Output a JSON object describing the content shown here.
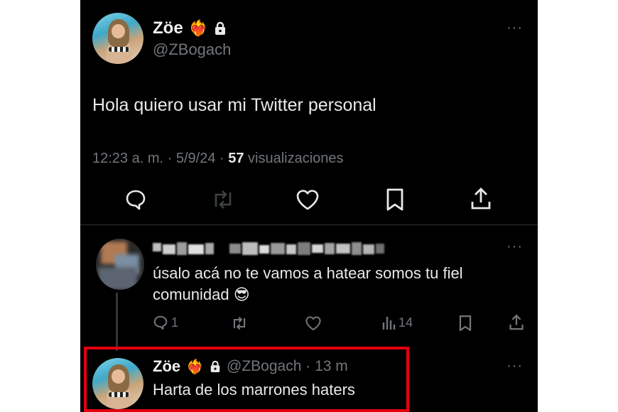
{
  "main_tweet": {
    "author_name": "Zöe",
    "name_emoji": "❤️‍🔥",
    "handle": "@ZBogach",
    "text": "Hola quiero usar mi Twitter personal",
    "time": "12:23 a. m. · 5/9/24 · ",
    "views_count": "57",
    "views_label": " visualizaciones",
    "more": "···"
  },
  "reply_1": {
    "text_line1": "úsalo acá no te vamos a hatear somos tu fiel",
    "text_line2": "comunidad",
    "emoji": "😎",
    "reply_count": "1",
    "views_count": "14",
    "more": "···"
  },
  "reply_2": {
    "author_name": "Zöe",
    "name_emoji": "❤️‍🔥",
    "meta": "@ZBogach · 13 m",
    "text": "Harta de los marrones haters",
    "more": "···"
  },
  "colors": {
    "background": "#000000",
    "muted": "#71767b",
    "highlight_border": "#e4000f"
  }
}
